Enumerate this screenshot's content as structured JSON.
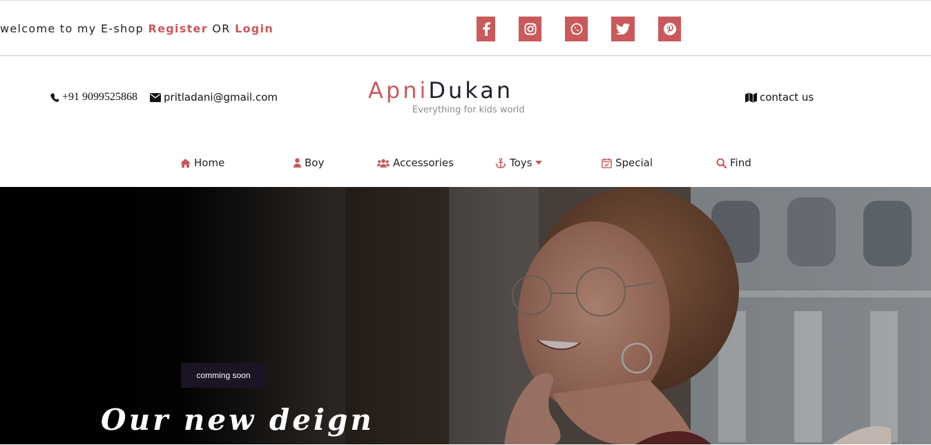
{
  "topbar": {
    "welcome_text": "welcome to my E-shop",
    "register_label": "Register",
    "or_text": "OR",
    "login_label": "Login",
    "social": [
      {
        "name": "facebook-icon"
      },
      {
        "name": "instagram-icon"
      },
      {
        "name": "whatsapp-icon"
      },
      {
        "name": "twitter-icon"
      },
      {
        "name": "pinterest-icon"
      }
    ]
  },
  "header": {
    "phone": "+91 9099525868",
    "email": "pritladani@gmail.com",
    "logo_part1": "Apni",
    "logo_part2": "Dukan",
    "tagline": "Everything for kids world",
    "contact_us": "contact us"
  },
  "nav": {
    "items": [
      {
        "label": "Home",
        "icon": "home-icon"
      },
      {
        "label": "Boy",
        "icon": "user-icon"
      },
      {
        "label": "Accessories",
        "icon": "users-icon"
      },
      {
        "label": "Toys",
        "icon": "anchor-icon"
      },
      {
        "label": "Special",
        "icon": "calendar-check-icon"
      },
      {
        "label": "Find",
        "icon": "search-icon"
      }
    ]
  },
  "hero": {
    "badge": "comming soon",
    "headline": "Our new deign"
  },
  "colors": {
    "accent": "#c9595a",
    "dark": "#20202a",
    "badge_bg": "#1b1424"
  }
}
